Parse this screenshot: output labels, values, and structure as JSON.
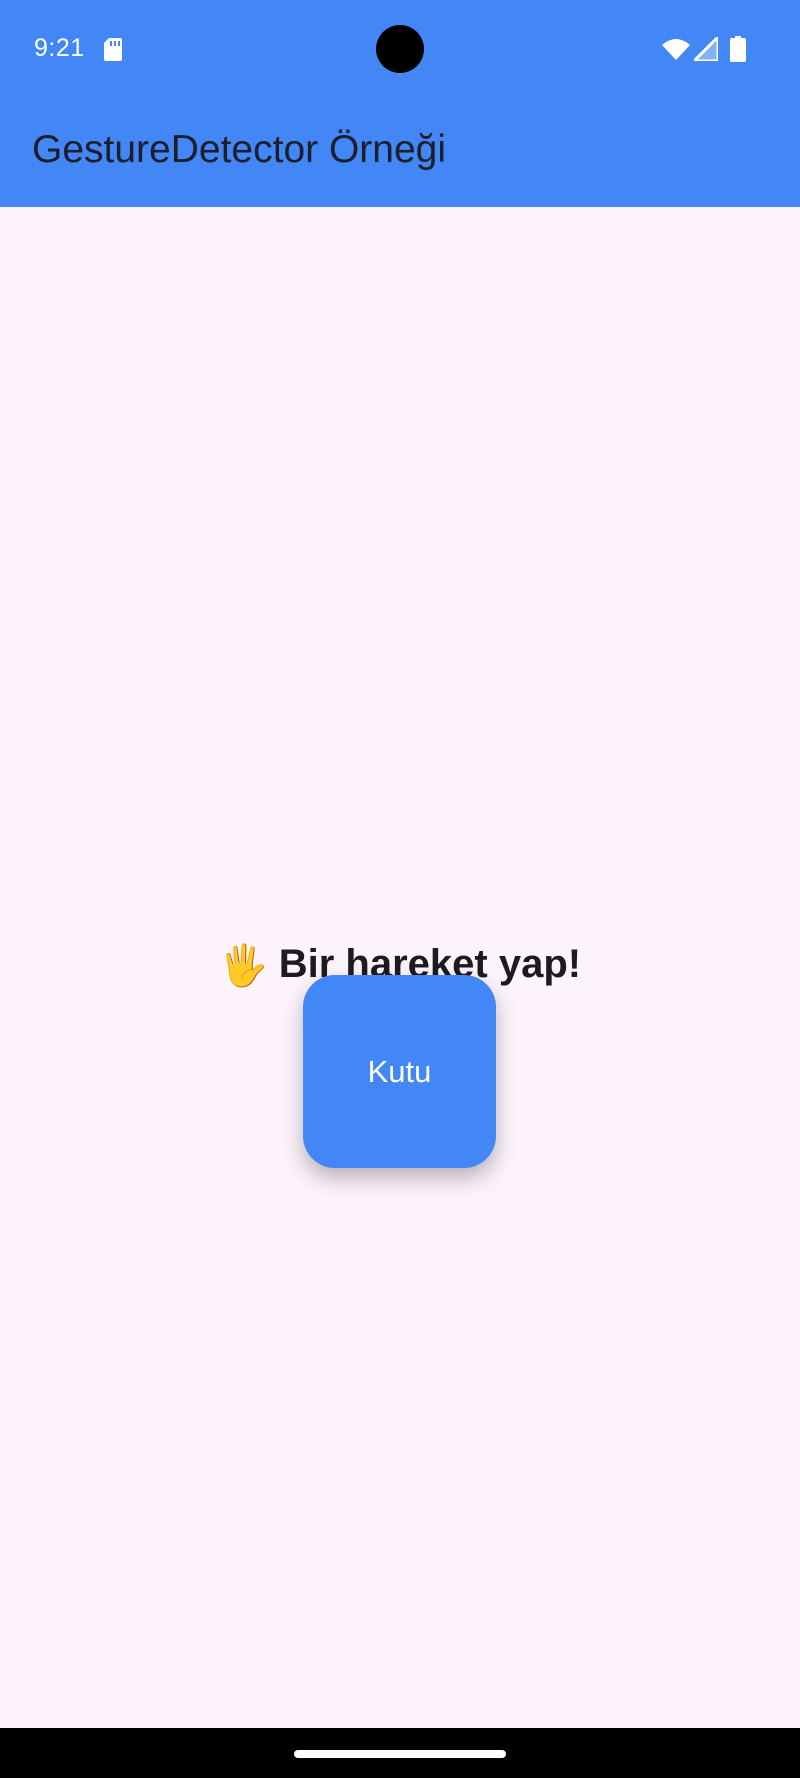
{
  "status_bar": {
    "time": "9:21",
    "color": "#4386f5",
    "icons": [
      "sd-card-icon",
      "wifi-icon",
      "cellular-signal-icon",
      "battery-icon"
    ]
  },
  "app_bar": {
    "title": "GestureDetector Örneği",
    "background": "#4386f5"
  },
  "main": {
    "message_emoji": "🖐",
    "message_text": "Bir hareket yap!",
    "box_label": "Kutu",
    "box_color": "#4386f5",
    "background": "#fdf4fb"
  }
}
